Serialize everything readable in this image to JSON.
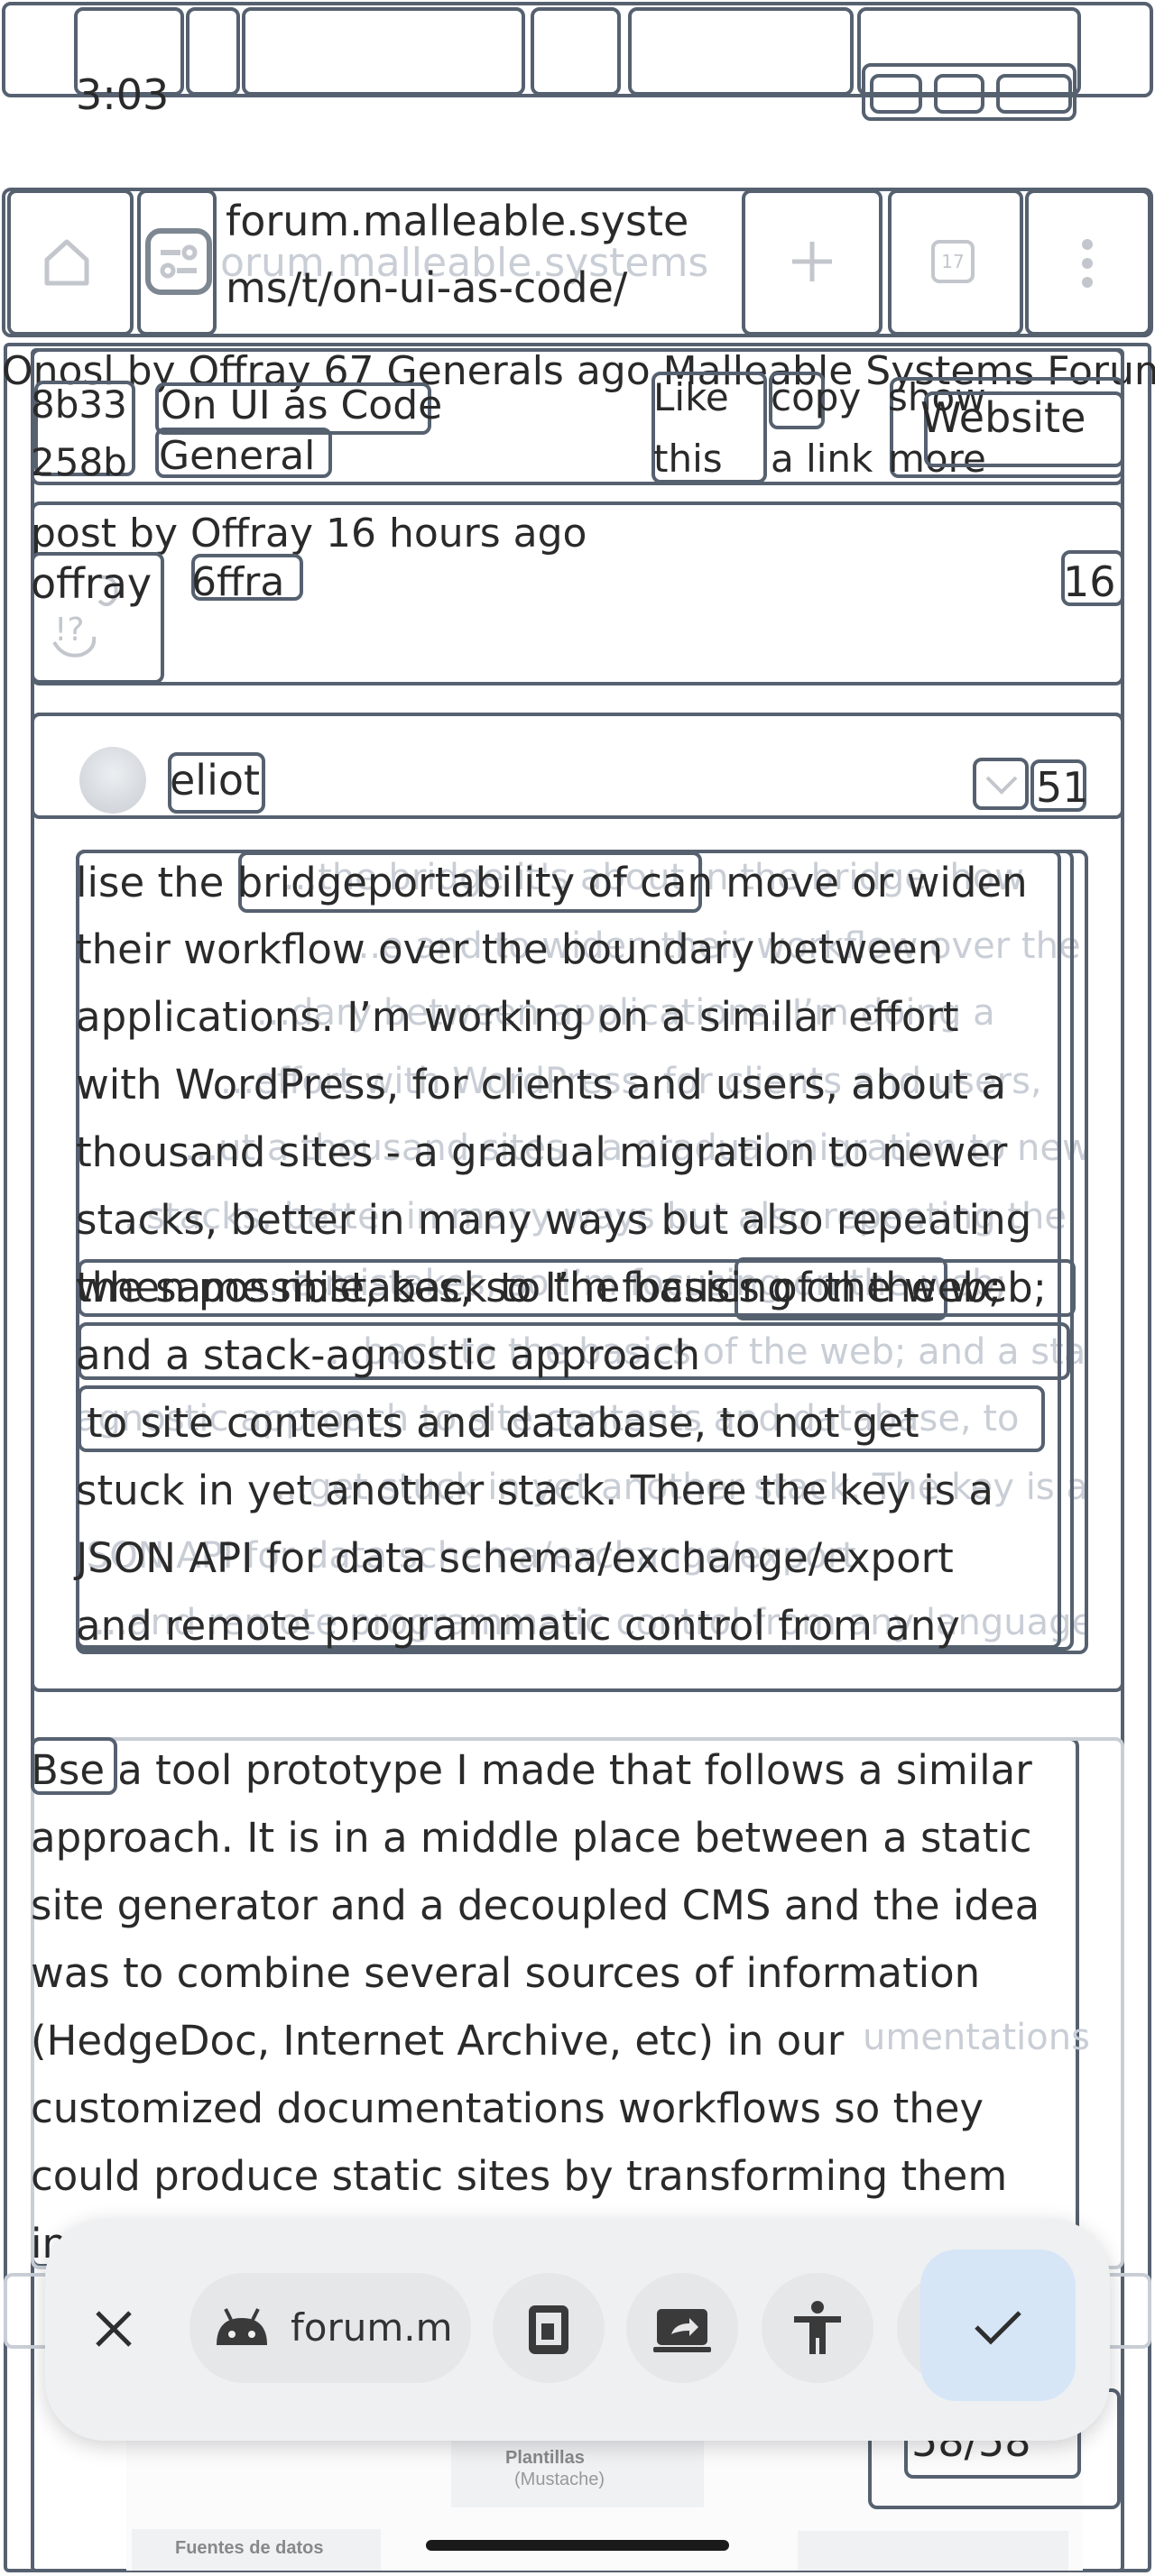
{
  "status": {
    "time": "3:03"
  },
  "browser": {
    "url_line1": "forum.malleable.syste",
    "url_line2": "ms/t/on-ui-as-code/",
    "url_ghost": "orum.malleable.systems",
    "tab_count": "17"
  },
  "topic": {
    "header_overlay": "Onosl by Offray 67 Generals ago Malleable Systems Forum",
    "id_line1": "8b33",
    "id_line2": "258b",
    "title": "On UI as Code",
    "category": "General",
    "like_l1": "Like",
    "like_l2": "this",
    "copy_l1": "copy",
    "copy_l2": "a link",
    "show_l1": "show",
    "show_l2": "more",
    "website": "Website"
  },
  "post1": {
    "meta": "post by Offray 16 hours ago",
    "author": "offray",
    "author_tag": "6ffra",
    "number": "16"
  },
  "post2": {
    "author": "eliot",
    "number": "51",
    "lines": [
      "lise the bridgeportability of can move or widen",
      "their workflow over the boundary between",
      "applications. I’m working on a similar effort",
      "with WordPress, for clients and users, about a",
      "thousand sites - a gradual migration to newer",
      "stacks, better in many ways but also repeating",
      "the same mistakes, so I’m focusing on the web;",
      "and a stack-agnostic approach",
      "to site contents and database, to not get",
      "stuck in yet another stack. There the key is a",
      "JSON API for data schema/exchange/export",
      "and remote programmatic control from any"
    ],
    "overlay_a": "when possible, back to the basics of the web;",
    "ghost_lines": [
      "...the bridge it's about in the bridge, how",
      "...e and to widen their workflow over the",
      "...dary between applications. I’m doing a",
      "...effort with WordPress, for clients and users,",
      "...ut a thousand sites - a gradual migration to newer",
      "...stacks, better in many ways but also repeating the",
      "...e mistakes, so I’m focusing on the web;",
      "...back to the basics of the web; and a stack-",
      "agnostic approach to site contents and database, to",
      "...get stuck in yet another stack. The key is a",
      "JSON API for data schema/exchange/export",
      "...and remote programmatic control from any language."
    ]
  },
  "post3": {
    "badge": "Bse",
    "lines": [
      "Bse a tool prototype I made that follows a similar",
      "approach. It is in a middle place between a static",
      "site generator and a decoupled CMS and the idea",
      "was to combine several sources of information",
      "(HedgeDoc, Internet Archive, etc) in our",
      "customized documentations workflows so they",
      "could produce static sites by transforming them",
      "in"
    ],
    "ghost_right": "umentations",
    "counter": "58/58",
    "diagram_l1": "Plantillas",
    "diagram_l2": "(Mustache)",
    "diagram_l3": "Fuentes de datos"
  },
  "bottom_bar": {
    "app_label": "forum.m"
  },
  "colors": {
    "outline": "#566170",
    "chip": "#e6e7e9",
    "confirm": "#d6e6f7",
    "bar": "#eff0f2"
  }
}
